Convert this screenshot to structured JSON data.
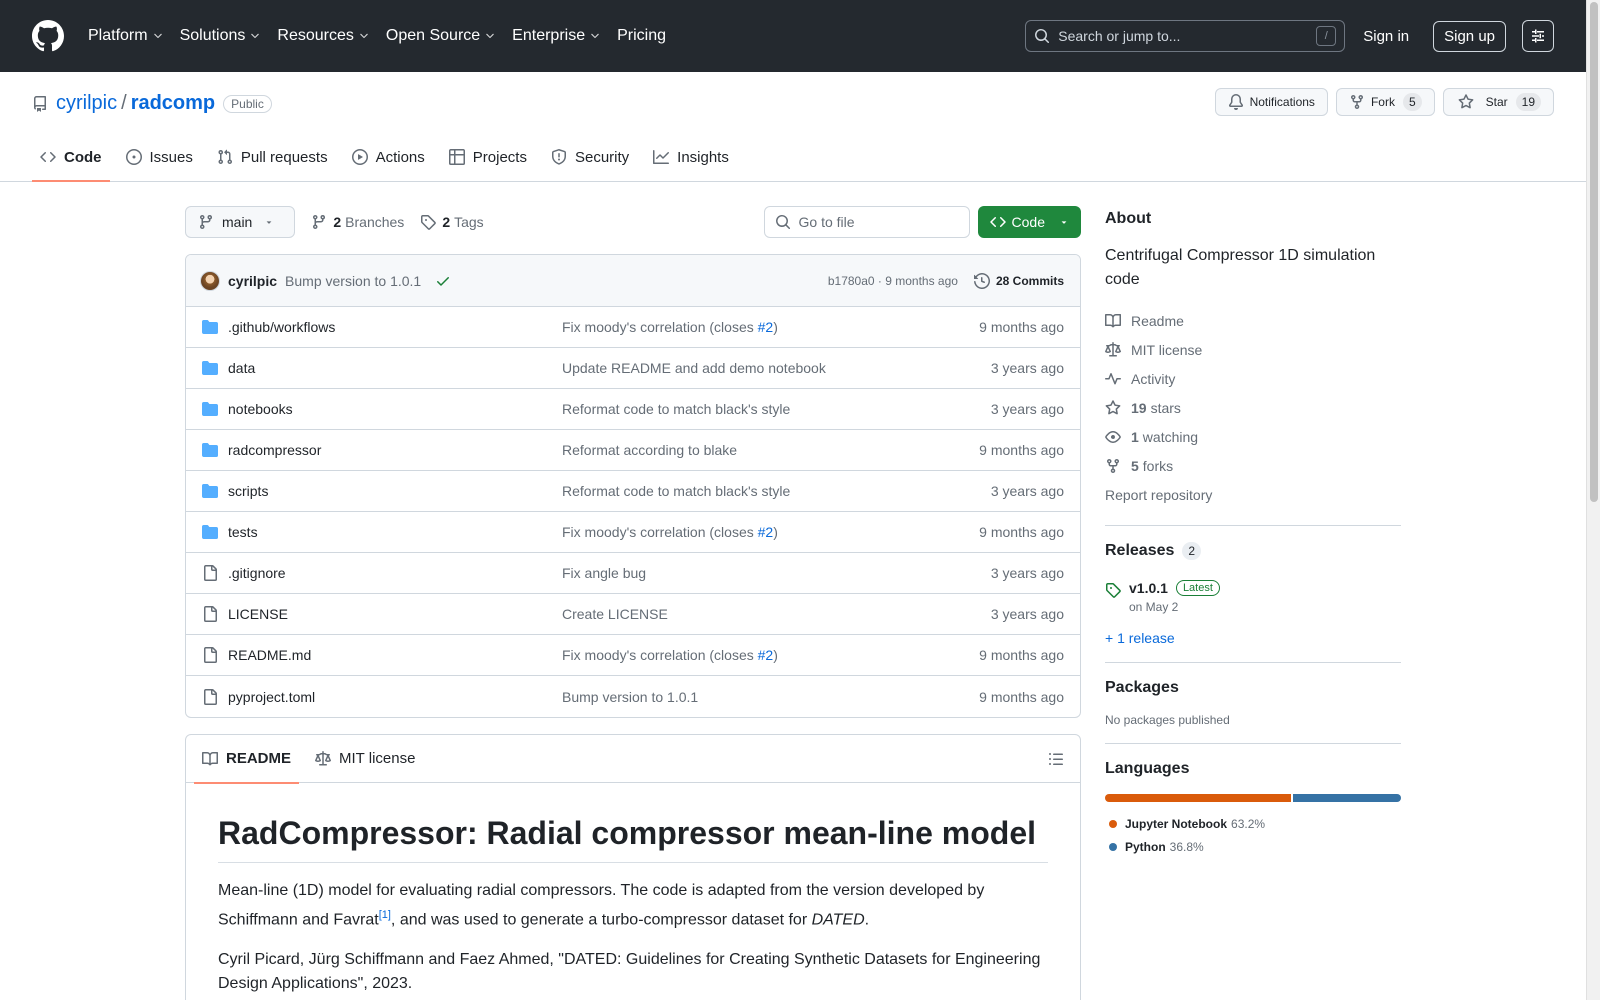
{
  "header": {
    "nav": [
      "Platform",
      "Solutions",
      "Resources",
      "Open Source",
      "Enterprise",
      "Pricing"
    ],
    "search_placeholder": "Search or jump to...",
    "slash": "/",
    "sign_in": "Sign in",
    "sign_up": "Sign up"
  },
  "repo": {
    "owner": "cyrilpic",
    "separator": "/",
    "name": "radcomp",
    "visibility": "Public",
    "notifications": "Notifications",
    "fork_label": "Fork",
    "fork_count": "5",
    "star_label": "Star",
    "star_count": "19",
    "tabs": [
      "Code",
      "Issues",
      "Pull requests",
      "Actions",
      "Projects",
      "Security",
      "Insights"
    ]
  },
  "filenav": {
    "branch": "main",
    "branches_count": "2",
    "branches_label": "Branches",
    "tags_count": "2",
    "tags_label": "Tags",
    "goto_placeholder": "Go to file",
    "code_button": "Code"
  },
  "commit": {
    "author": "cyrilpic",
    "message": "Bump version to 1.0.1",
    "sha_time": "b1780a0 · 9 months ago",
    "commits": "28 Commits"
  },
  "files": [
    {
      "type": "dir",
      "name": ".github/workflows",
      "msg": "Fix moody's correlation (closes ",
      "ref": "#2",
      "tail": ")",
      "date": "9 months ago"
    },
    {
      "type": "dir",
      "name": "data",
      "msg": "Update README and add demo notebook",
      "ref": "",
      "tail": "",
      "date": "3 years ago"
    },
    {
      "type": "dir",
      "name": "notebooks",
      "msg": "Reformat code to match black's style",
      "ref": "",
      "tail": "",
      "date": "3 years ago"
    },
    {
      "type": "dir",
      "name": "radcompressor",
      "msg": "Reformat according to blake",
      "ref": "",
      "tail": "",
      "date": "9 months ago"
    },
    {
      "type": "dir",
      "name": "scripts",
      "msg": "Reformat code to match black's style",
      "ref": "",
      "tail": "",
      "date": "3 years ago"
    },
    {
      "type": "dir",
      "name": "tests",
      "msg": "Fix moody's correlation (closes ",
      "ref": "#2",
      "tail": ")",
      "date": "9 months ago"
    },
    {
      "type": "file",
      "name": ".gitignore",
      "msg": "Fix angle bug",
      "ref": "",
      "tail": "",
      "date": "3 years ago"
    },
    {
      "type": "file",
      "name": "LICENSE",
      "msg": "Create LICENSE",
      "ref": "",
      "tail": "",
      "date": "3 years ago"
    },
    {
      "type": "file",
      "name": "README.md",
      "msg": "Fix moody's correlation (closes ",
      "ref": "#2",
      "tail": ")",
      "date": "9 months ago"
    },
    {
      "type": "file",
      "name": "pyproject.toml",
      "msg": "Bump version to 1.0.1",
      "ref": "",
      "tail": "",
      "date": "9 months ago"
    }
  ],
  "readme": {
    "tab_readme": "README",
    "tab_license": "MIT license",
    "title": "RadCompressor: Radial compressor mean-line model",
    "p1_a": "Mean-line (1D) model for evaluating radial compressors. The code is adapted from the version developed by Schiffmann and Favrat",
    "p1_sup": "[1]",
    "p1_b": ", and was used to generate a turbo-compressor dataset for ",
    "p1_em": "DATED",
    "p1_c": ".",
    "p2": "Cyril Picard, Jürg Schiffmann and Faez Ahmed, \"DATED: Guidelines for Creating Synthetic Datasets for Engineering Design Applications\", 2023."
  },
  "about": {
    "title": "About",
    "description": "Centrifugal Compressor 1D simulation code",
    "readme": "Readme",
    "license": "MIT license",
    "activity": "Activity",
    "stars_count": "19",
    "stars_label": "stars",
    "watching_count": "1",
    "watching_label": "watching",
    "forks_count": "5",
    "forks_label": "forks",
    "report": "Report repository"
  },
  "releases": {
    "title": "Releases",
    "count": "2",
    "tag": "v1.0.1",
    "latest": "Latest",
    "date": "on May 2",
    "more": "+ 1 release"
  },
  "packages": {
    "title": "Packages",
    "empty": "No packages published"
  },
  "languages": {
    "title": "Languages",
    "items": [
      {
        "name": "Jupyter Notebook",
        "pct": "63.2%",
        "value": 63.2,
        "color": "#DA5B0B"
      },
      {
        "name": "Python",
        "pct": "36.8%",
        "value": 36.8,
        "color": "#3572A5"
      }
    ]
  }
}
